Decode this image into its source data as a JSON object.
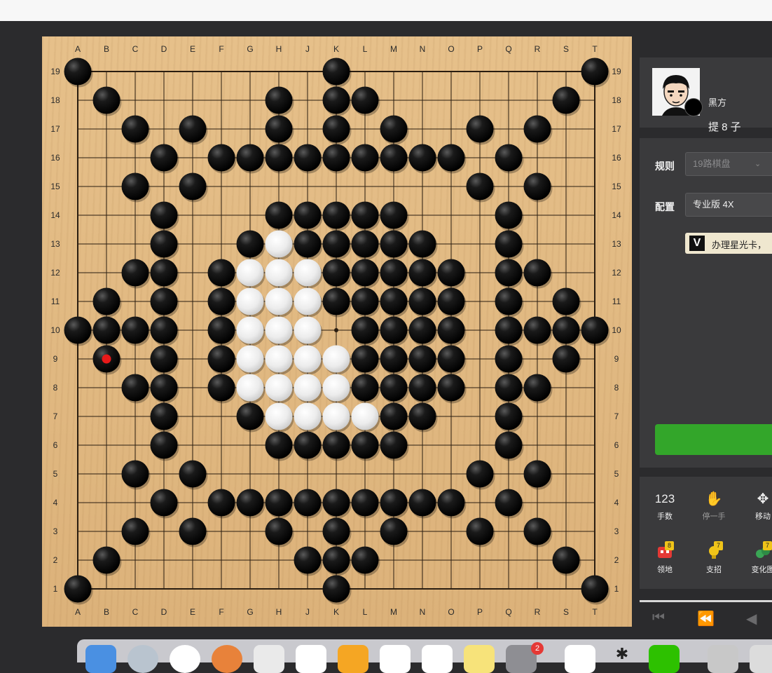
{
  "board": {
    "size": 19,
    "columns": [
      "A",
      "B",
      "C",
      "D",
      "E",
      "F",
      "G",
      "H",
      "J",
      "K",
      "L",
      "M",
      "N",
      "O",
      "P",
      "Q",
      "R",
      "S",
      "T"
    ],
    "rows": [
      "19",
      "18",
      "17",
      "16",
      "15",
      "14",
      "13",
      "12",
      "11",
      "10",
      "9",
      "8",
      "7",
      "6",
      "5",
      "4",
      "3",
      "2",
      "1"
    ],
    "star_points": [
      "K10"
    ],
    "last_move": "B9",
    "last_move_color": "#e81919",
    "black_stones": [
      "A19",
      "K19",
      "T19",
      "B18",
      "H18",
      "K18",
      "L18",
      "S18",
      "C17",
      "E17",
      "H17",
      "K17",
      "M17",
      "P17",
      "R17",
      "D16",
      "F16",
      "G16",
      "H16",
      "J16",
      "K16",
      "L16",
      "M16",
      "N16",
      "O16",
      "Q16",
      "C15",
      "E15",
      "P15",
      "R15",
      "D14",
      "H14",
      "J14",
      "K14",
      "L14",
      "M14",
      "Q14",
      "D13",
      "G13",
      "J13",
      "K13",
      "L13",
      "M13",
      "N13",
      "Q13",
      "C12",
      "D12",
      "F12",
      "K12",
      "L12",
      "M12",
      "N12",
      "O12",
      "Q12",
      "R12",
      "B11",
      "D11",
      "F11",
      "K11",
      "L11",
      "M11",
      "N11",
      "O11",
      "Q11",
      "S11",
      "A10",
      "B10",
      "C10",
      "D10",
      "F10",
      "L10",
      "M10",
      "N10",
      "O10",
      "Q10",
      "R10",
      "S10",
      "T10",
      "B9",
      "D9",
      "F9",
      "L9",
      "M9",
      "N9",
      "O9",
      "Q9",
      "S9",
      "C8",
      "D8",
      "F8",
      "L8",
      "M8",
      "N8",
      "O8",
      "Q8",
      "R8",
      "D7",
      "G7",
      "M7",
      "N7",
      "Q7",
      "D6",
      "H6",
      "J6",
      "K6",
      "L6",
      "M6",
      "Q6",
      "C5",
      "E5",
      "P5",
      "R5",
      "D4",
      "F4",
      "G4",
      "H4",
      "J4",
      "K4",
      "L4",
      "M4",
      "N4",
      "O4",
      "Q4",
      "C3",
      "E3",
      "H3",
      "K3",
      "M3",
      "P3",
      "R3",
      "B2",
      "J2",
      "K2",
      "L2",
      "S2",
      "A1",
      "K1",
      "T1"
    ],
    "white_stones": [
      "H13",
      "G12",
      "H12",
      "J12",
      "G11",
      "H11",
      "J11",
      "G10",
      "H10",
      "J10",
      "G9",
      "H9",
      "J9",
      "K9",
      "G8",
      "H8",
      "J8",
      "K8",
      "H7",
      "J7",
      "K7",
      "L7"
    ]
  },
  "player": {
    "name": "黑方",
    "captures": "提 8 子"
  },
  "settings": {
    "rule_label": "规则",
    "rule_value": "19路棋盘",
    "config_label": "配置",
    "config_value": "专业版 4X",
    "promo_text": "办理星光卡，"
  },
  "tools": [
    {
      "label": "手数",
      "icon": "123",
      "icon_name": "move-number-icon"
    },
    {
      "label": "停一手",
      "icon": "✋",
      "icon_name": "hand-icon"
    },
    {
      "label": "移动",
      "icon": "✥",
      "icon_name": "move-arrows-icon"
    }
  ],
  "tools2": [
    {
      "label": "领地",
      "badge": "8",
      "icon_name": "territory-icon"
    },
    {
      "label": "支招",
      "badge": "7",
      "icon_name": "hint-icon"
    },
    {
      "label": "变化图",
      "badge": "7",
      "icon_name": "variation-icon"
    }
  ],
  "dock_badge": "2",
  "colors": {
    "accent_green": "#33a62a",
    "badge_yellow": "#f0c419",
    "board_wood": "#dcb27a"
  }
}
